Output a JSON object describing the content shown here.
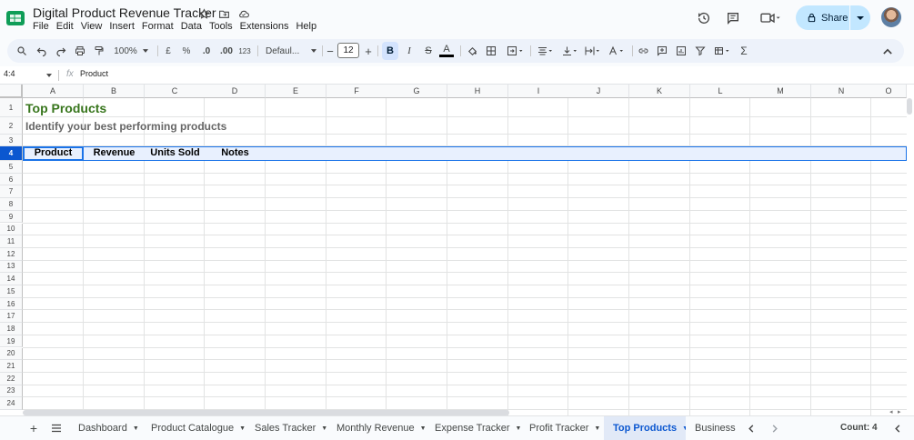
{
  "header": {
    "doc_title": "Digital Product Revenue Tracker",
    "menu": [
      "File",
      "Edit",
      "View",
      "Insert",
      "Format",
      "Data",
      "Tools",
      "Extensions",
      "Help"
    ],
    "share_label": "Share"
  },
  "toolbar": {
    "zoom": "100%",
    "currency": "£",
    "percent": "%",
    "dec_decrease": ".0",
    "dec_increase": ".00",
    "number_format": "123",
    "font": "Defaul...",
    "font_size": "12",
    "bold": "B",
    "italic": "I",
    "strike": "S",
    "text_color": "A",
    "sum": "Σ"
  },
  "formula_bar": {
    "name_box": "4:4",
    "fx": "fx",
    "value": "Product"
  },
  "columns": [
    "A",
    "B",
    "C",
    "D",
    "E",
    "F",
    "G",
    "H",
    "I",
    "J",
    "K",
    "L",
    "M",
    "N",
    "O"
  ],
  "rows": [
    "1",
    "2",
    "3",
    "4",
    "5",
    "6",
    "7",
    "8",
    "9",
    "10",
    "11",
    "12",
    "13",
    "14",
    "15",
    "16",
    "17",
    "18",
    "19",
    "20",
    "21",
    "22",
    "23",
    "24"
  ],
  "cells": {
    "title": "Top Products",
    "subtitle": "Identify your best performing products",
    "headers": [
      "Product",
      "Revenue",
      "Units Sold",
      "Notes"
    ]
  },
  "sheets": [
    {
      "name": "Dashboard",
      "active": false
    },
    {
      "name": "Product Catalogue",
      "active": false
    },
    {
      "name": "Sales Tracker",
      "active": false
    },
    {
      "name": "Monthly Revenue",
      "active": false
    },
    {
      "name": "Expense Tracker",
      "active": false
    },
    {
      "name": "Profit Tracker",
      "active": false
    },
    {
      "name": "Top Products",
      "active": true
    },
    {
      "name": "Business (",
      "active": false
    }
  ],
  "status": {
    "count": "Count: 4"
  },
  "colors": {
    "accent": "#0b57d0",
    "title_green": "#38761d",
    "share_bg": "#c2e7ff"
  }
}
